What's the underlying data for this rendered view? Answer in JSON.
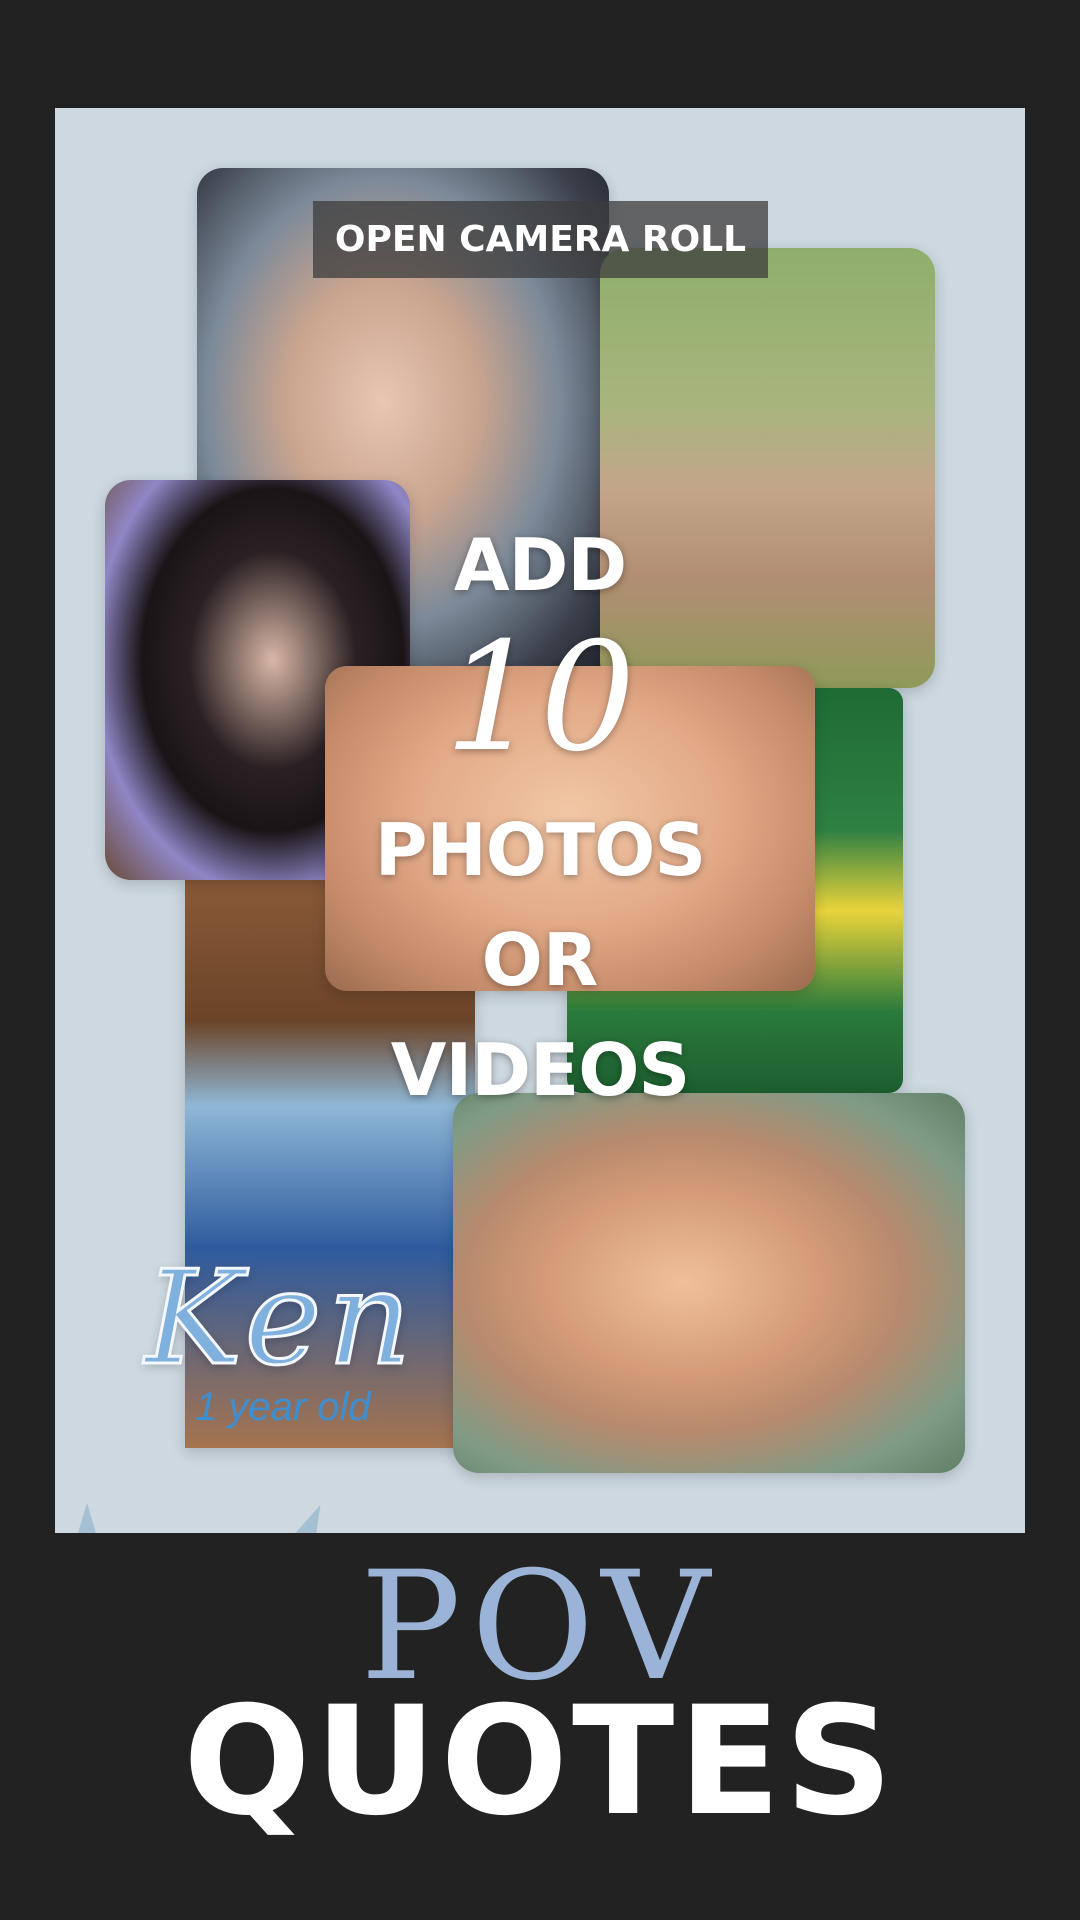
{
  "canvas": {
    "background_color": "#cdd8e0",
    "photos": [
      {
        "id": "photo-1",
        "subject": "sleeping-newborn-hat"
      },
      {
        "id": "photo-2",
        "subject": "baby-knit-outfit-outdoors"
      },
      {
        "id": "photo-3",
        "subject": "newborn-with-crown"
      },
      {
        "id": "photo-4",
        "subject": "newborn-blue-wrap"
      },
      {
        "id": "photo-5",
        "subject": "baby-face-closeup"
      },
      {
        "id": "photo-6",
        "subject": "baby-bee-costume"
      },
      {
        "id": "photo-7",
        "subject": "baby-knit-hat-portrait"
      }
    ]
  },
  "toolbar": {
    "open_camera_roll_label": "OPEN CAMERA ROLL"
  },
  "overlay": {
    "add": "ADD",
    "count": "10",
    "photos": "PHOTOS",
    "or": "OR",
    "videos": "VIDEOS"
  },
  "name_card": {
    "name": "Ken",
    "age": "1 year old",
    "color": "#3d8fd1"
  },
  "footer": {
    "pov": "POV",
    "quotes": "QUOTES",
    "pov_color": "#9ab3d6",
    "quotes_color": "#ffffff"
  }
}
